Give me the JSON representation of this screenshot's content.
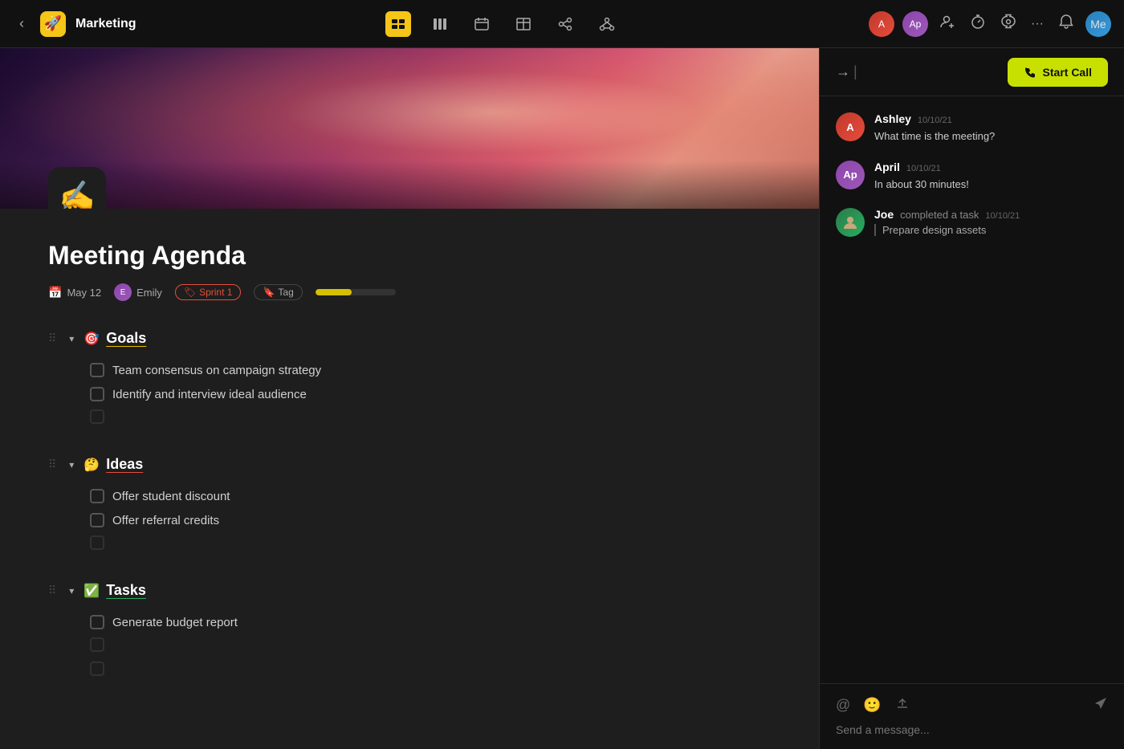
{
  "app": {
    "title": "Marketing",
    "back_label": "‹",
    "logo_emoji": "🚀"
  },
  "nav": {
    "tools": [
      {
        "id": "list",
        "emoji": "≡",
        "active": true
      },
      {
        "id": "grid",
        "emoji": "⊞"
      },
      {
        "id": "calendar",
        "emoji": "⊡"
      },
      {
        "id": "table",
        "emoji": "⊟"
      },
      {
        "id": "share",
        "emoji": "⇄"
      },
      {
        "id": "graph",
        "emoji": "⊛"
      }
    ]
  },
  "doc": {
    "icon": "✍️",
    "title": "Meeting Agenda",
    "meta": {
      "date": "May 12",
      "assignee": "Emily",
      "sprint": "Sprint 1",
      "tag_label": "Tag"
    },
    "sections": [
      {
        "id": "goals",
        "emoji": "🎯",
        "title": "Goals",
        "underline_color": "#e8c000",
        "items": [
          "Team consensus on campaign strategy",
          "Identify and interview ideal audience"
        ]
      },
      {
        "id": "ideas",
        "emoji": "🤔",
        "title": "Ideas",
        "underline_color": "#e74c3c",
        "items": [
          "Offer student discount",
          "Offer referral credits"
        ]
      },
      {
        "id": "tasks",
        "emoji": "✅",
        "title": "Tasks",
        "underline_color": "#27ae60",
        "items": [
          "Generate budget report"
        ]
      }
    ]
  },
  "chat": {
    "start_call_label": "Start Call",
    "messages": [
      {
        "author": "Ashley",
        "time": "10/10/21",
        "text": "What time is the meeting?",
        "type": "message"
      },
      {
        "author": "April",
        "time": "10/10/21",
        "text": "In about 30 minutes!",
        "type": "message"
      },
      {
        "author": "Joe",
        "time": "10/10/21",
        "text": "completed a task",
        "task": "Prepare design assets",
        "type": "task"
      }
    ],
    "input_placeholder": "Send a message..."
  }
}
